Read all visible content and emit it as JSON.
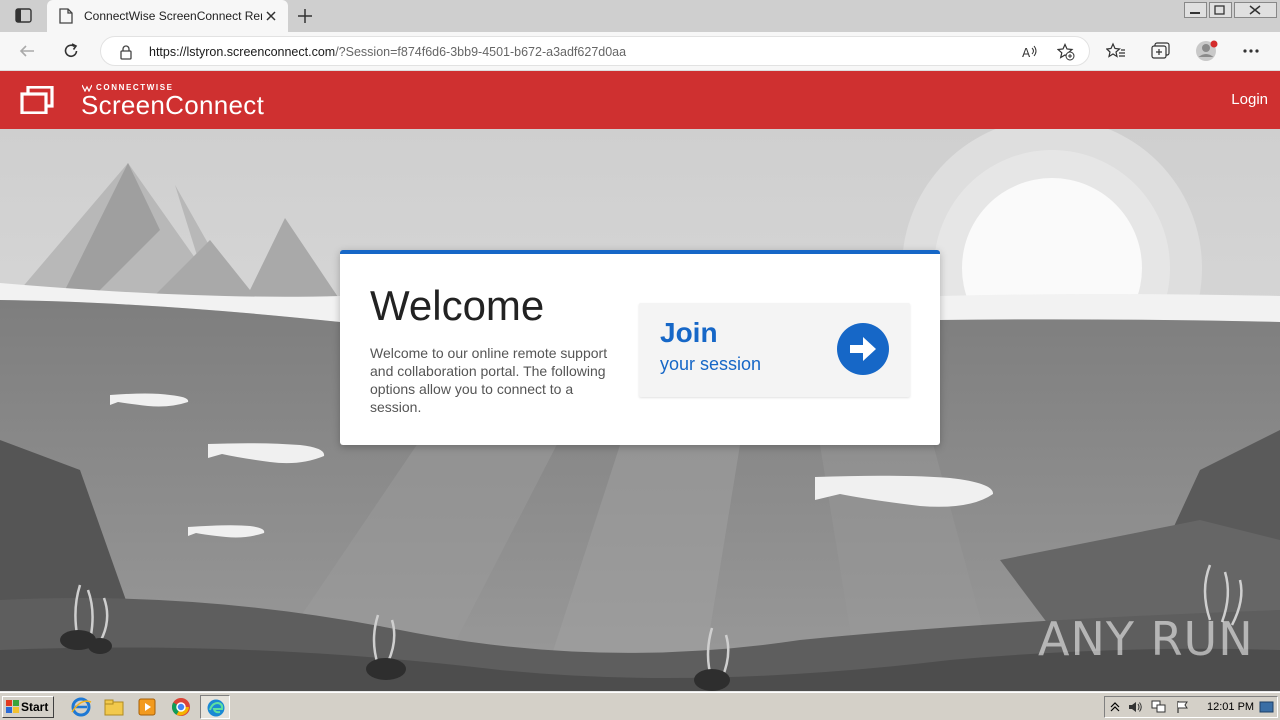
{
  "browser": {
    "tab_title": "ConnectWise ScreenConnect Rem",
    "url_host": "https://lstyron.screenconnect.com",
    "url_rest": "/?Session=f874f6d6-3bb9-4501-b672-a3adf627d0aa"
  },
  "app": {
    "brand_small": "CONNECTWISE",
    "brand_name": "ScreenConnect",
    "login_label": "Login"
  },
  "welcome": {
    "title": "Welcome",
    "text": "Welcome to our online remote support and collaboration portal. The following options allow you to connect to a session.",
    "join_title": "Join",
    "join_subtitle": "your session"
  },
  "watermark": "ANY RUN",
  "taskbar": {
    "start_label": "Start",
    "clock": "12:01 PM"
  },
  "colors": {
    "brand_red": "#cf3030",
    "accent_blue": "#1667c7"
  }
}
